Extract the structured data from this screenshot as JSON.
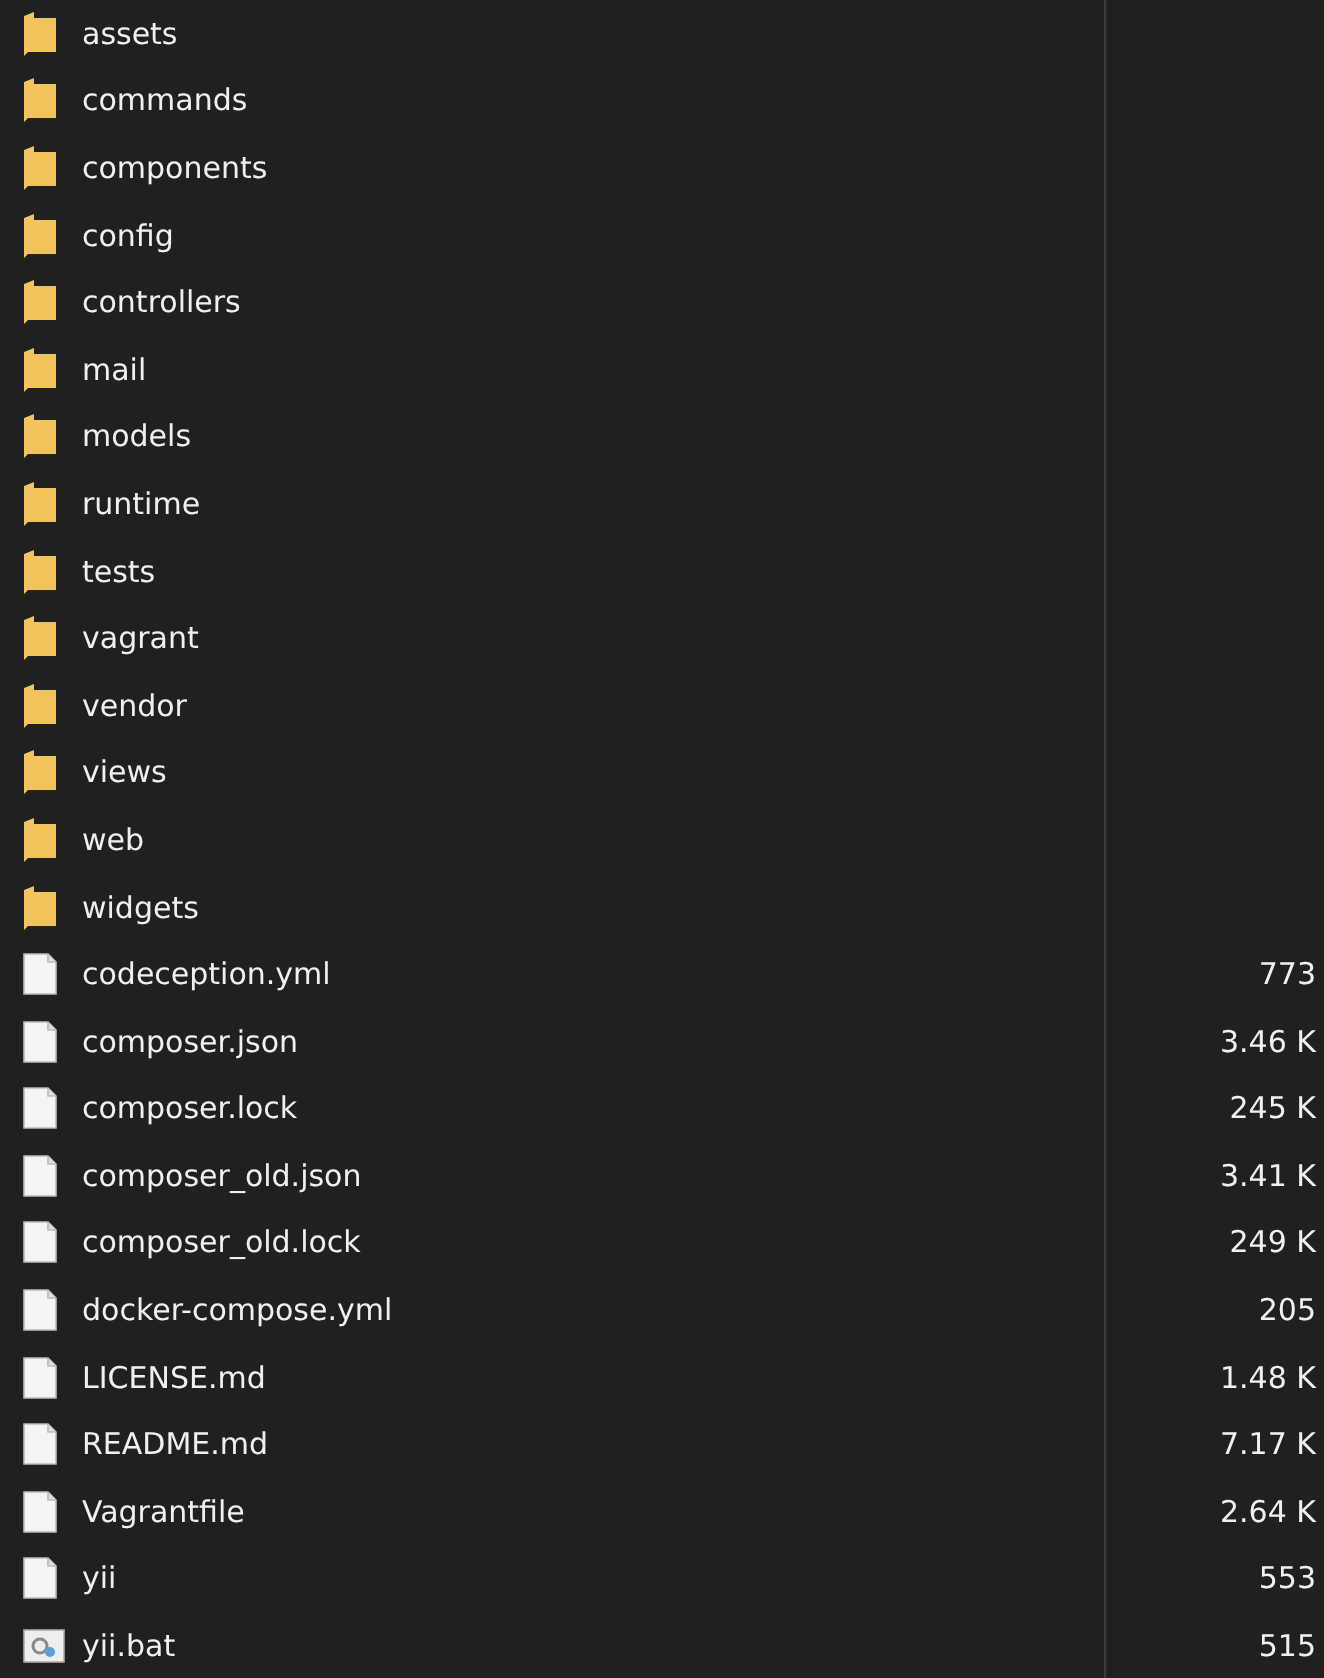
{
  "files": [
    {
      "kind": "folder",
      "name": "assets"
    },
    {
      "kind": "folder",
      "name": "commands"
    },
    {
      "kind": "folder",
      "name": "components"
    },
    {
      "kind": "folder",
      "name": "config"
    },
    {
      "kind": "folder",
      "name": "controllers"
    },
    {
      "kind": "folder",
      "name": "mail"
    },
    {
      "kind": "folder",
      "name": "models"
    },
    {
      "kind": "folder",
      "name": "runtime"
    },
    {
      "kind": "folder",
      "name": "tests"
    },
    {
      "kind": "folder",
      "name": "vagrant"
    },
    {
      "kind": "folder",
      "name": "vendor"
    },
    {
      "kind": "folder",
      "name": "views"
    },
    {
      "kind": "folder",
      "name": "web"
    },
    {
      "kind": "folder",
      "name": "widgets"
    },
    {
      "kind": "file",
      "name": "codeception.yml",
      "size": "773"
    },
    {
      "kind": "file",
      "name": "composer.json",
      "size": "3.46 K"
    },
    {
      "kind": "file",
      "name": "composer.lock",
      "size": "245 K"
    },
    {
      "kind": "file",
      "name": "composer_old.json",
      "size": "3.41 K"
    },
    {
      "kind": "file",
      "name": "composer_old.lock",
      "size": "249 K"
    },
    {
      "kind": "file",
      "name": "docker-compose.yml",
      "size": "205"
    },
    {
      "kind": "file",
      "name": "LICENSE.md",
      "size": "1.48 K"
    },
    {
      "kind": "file",
      "name": "README.md",
      "size": "7.17 K"
    },
    {
      "kind": "file",
      "name": "Vagrantfile",
      "size": "2.64 K"
    },
    {
      "kind": "file",
      "name": "yii",
      "size": "553"
    },
    {
      "kind": "batch",
      "name": "yii.bat",
      "size": "515"
    }
  ]
}
